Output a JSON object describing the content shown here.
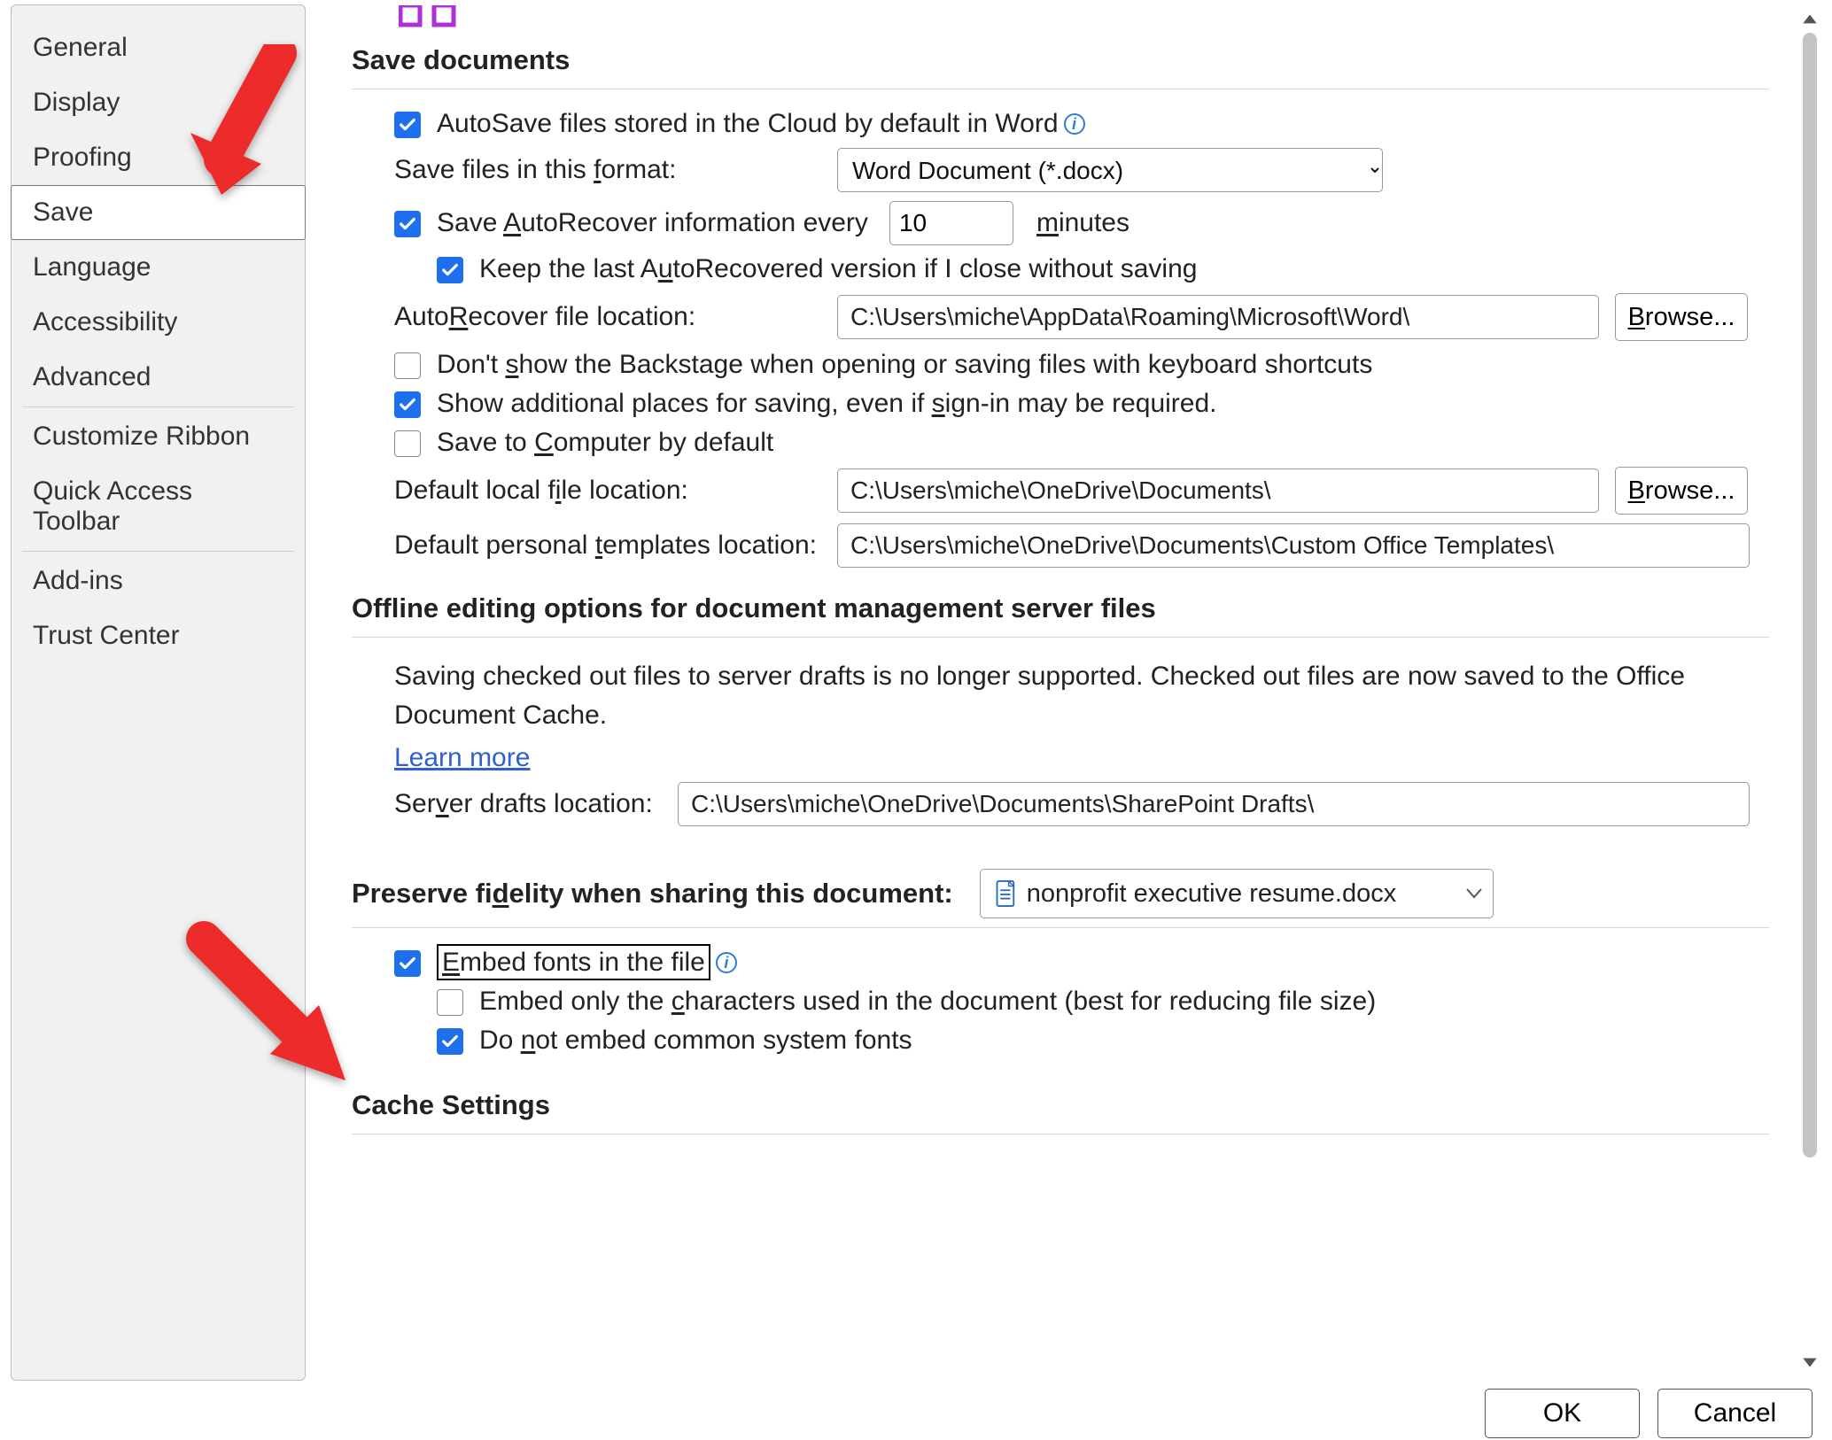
{
  "sidebar": {
    "items": [
      {
        "label": "General"
      },
      {
        "label": "Display"
      },
      {
        "label": "Proofing"
      },
      {
        "label": "Save"
      },
      {
        "label": "Language"
      },
      {
        "label": "Accessibility"
      },
      {
        "label": "Advanced"
      },
      {
        "label": "Customize Ribbon"
      },
      {
        "label": "Quick Access Toolbar"
      },
      {
        "label": "Add-ins"
      },
      {
        "label": "Trust Center"
      }
    ],
    "selected_index": 3
  },
  "section_save_documents": {
    "title": "Save documents",
    "autosave_label": "AutoSave files stored in the Cloud by default in Word",
    "autosave_checked": true,
    "save_format_label_pre": "Save files in this ",
    "save_format_label_u": "f",
    "save_format_label_post": "ormat:",
    "save_format_value": "Word Document (*.docx)",
    "autorecover": {
      "label_pre": "Save ",
      "label_u": "A",
      "label_post": "utoRecover information every",
      "checked": true,
      "minutes_value": "10",
      "minutes_unit_u": "m",
      "minutes_unit_post": "inutes"
    },
    "keep_last": {
      "label_pre": "Keep the last A",
      "label_u": "u",
      "label_post": "toRecovered version if I close without saving",
      "checked": true
    },
    "autorecover_loc": {
      "label_pre": "Auto",
      "label_u": "R",
      "label_post": "ecover file location:",
      "value": "C:\\Users\\miche\\AppData\\Roaming\\Microsoft\\Word\\",
      "browse_pre": "",
      "browse_u": "B",
      "browse_post": "rowse..."
    },
    "dont_show_backstage": {
      "label_pre": "Don't ",
      "label_u": "s",
      "label_post": "how the Backstage when opening or saving files with keyboard shortcuts",
      "checked": false
    },
    "show_additional": {
      "label_pre": "Show additional places for saving, even if ",
      "label_u": "s",
      "label_post": "ign-in may be required.",
      "checked": true
    },
    "save_to_computer": {
      "label_pre": "Save to ",
      "label_u": "C",
      "label_post": "omputer by default",
      "checked": false
    },
    "default_local": {
      "label_pre": "Default local f",
      "label_u": "i",
      "label_post": "le location:",
      "value": "C:\\Users\\miche\\OneDrive\\Documents\\",
      "browse_pre": "",
      "browse_u": "B",
      "browse_post": "rowse..."
    },
    "default_templates": {
      "label_pre": "Default personal ",
      "label_u": "t",
      "label_post": "emplates location:",
      "value": "C:\\Users\\miche\\OneDrive\\Documents\\Custom Office Templates\\"
    }
  },
  "section_offline": {
    "title": "Offline editing options for document management server files",
    "note": "Saving checked out files to server drafts is no longer supported. Checked out files are now saved to the Office Document Cache.",
    "learn_more": "Learn more",
    "drafts": {
      "label_pre": "Ser",
      "label_u": "v",
      "label_post": "er drafts location:",
      "value": "C:\\Users\\miche\\OneDrive\\Documents\\SharePoint Drafts\\"
    }
  },
  "section_preserve": {
    "title_pre": "Preserve fi",
    "title_u": "d",
    "title_post": "elity when sharing this document:",
    "document_value": "nonprofit executive resume.docx",
    "embed_fonts": {
      "label_pre": "",
      "label_u": "E",
      "label_post": "mbed fonts in the file",
      "checked": true
    },
    "embed_only": {
      "label_pre": "Embed only the ",
      "label_u": "c",
      "label_post": "haracters used in the document (best for reducing file size)",
      "checked": false
    },
    "dont_embed_common": {
      "label_pre": "Do ",
      "label_u": "n",
      "label_post": "ot embed common system fonts",
      "checked": true
    }
  },
  "section_cache": {
    "title": "Cache Settings"
  },
  "footer": {
    "ok": "OK",
    "cancel": "Cancel"
  }
}
